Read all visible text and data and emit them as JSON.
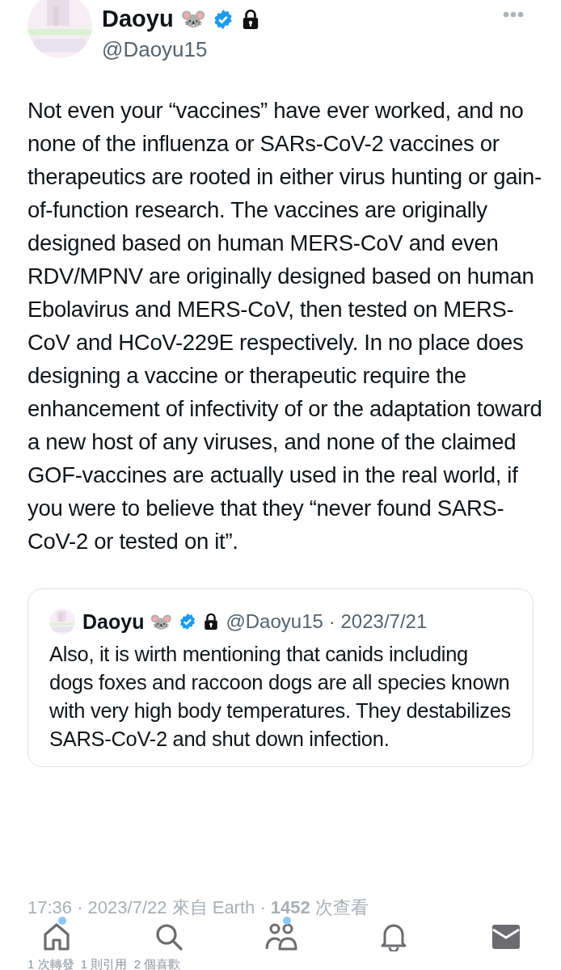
{
  "author": {
    "name": "Daoyu",
    "emoji": "🐭",
    "verified": true,
    "protected": true,
    "handle": "@Daoyu15"
  },
  "body": "Not even your “vaccines” have ever worked, and no none of the influenza or SARs-CoV-2 vaccines or therapeutics are rooted in either virus hunting or gain-of-function research. The vaccines are originally designed based on human MERS-CoV and even RDV/MPNV are originally designed based on human Ebolavirus and MERS-CoV, then tested on MERS-CoV and HCoV-229E respectively. In no place does designing a vaccine or therapeutic require the enhancement of infectivity of or the adaptation toward a new host of any viruses, and none of the claimed GOF-vaccines are actually used in the real world, if you were to believe that they “never found SARS-CoV-2 or tested on it”.",
  "quote": {
    "name": "Daoyu",
    "emoji": "🐭",
    "verified": true,
    "protected": true,
    "handle": "@Daoyu15",
    "date": "· 2023/7/21",
    "text": "Also, it is wirth mentioning that canids including dogs foxes and raccoon dogs are all species known with very high body temperatures. They destabilizes SARS-CoV-2 and shut down infection."
  },
  "meta": "17:36 · 2023/7/22 來自 Earth · **1452** 次查看",
  "stats": "1 次轉發  1 則引用  2 個喜歡",
  "tab_bar": [
    {
      "kind": "home",
      "badge": true
    },
    {
      "kind": "search",
      "badge": false
    },
    {
      "kind": "communities",
      "badge": true
    },
    {
      "kind": "notifications",
      "badge": false
    },
    {
      "kind": "messages",
      "badge": false
    }
  ]
}
